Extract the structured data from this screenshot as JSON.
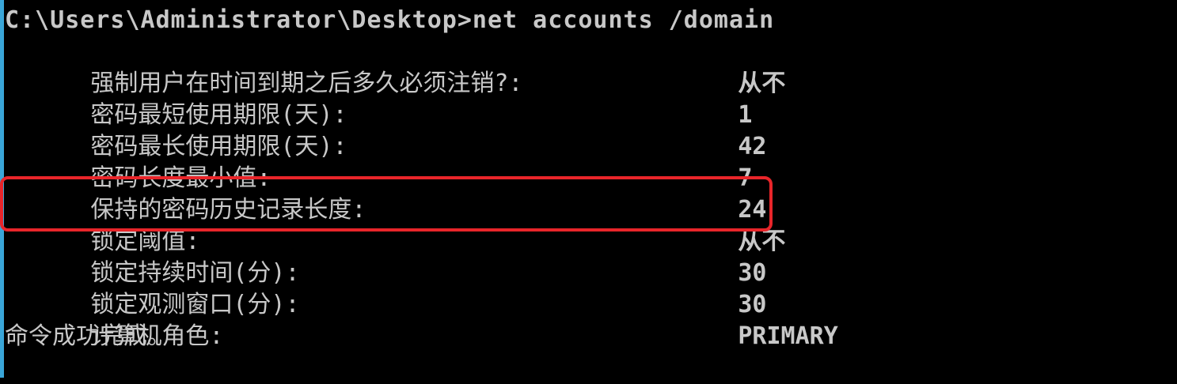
{
  "prompt_line": "C:\\Users\\Administrator\\Desktop>net accounts /domain",
  "rows": [
    {
      "label": "强制用户在时间到期之后多久必须注销?:",
      "value": "从不"
    },
    {
      "label": "密码最短使用期限(天):",
      "value": "1"
    },
    {
      "label": "密码最长使用期限(天):",
      "value": "42"
    },
    {
      "label": "密码长度最小值:",
      "value": "7"
    },
    {
      "label": "保持的密码历史记录长度:",
      "value": "24"
    },
    {
      "label": "锁定阈值:",
      "value": "从不"
    },
    {
      "label": "锁定持续时间(分):",
      "value": "30"
    },
    {
      "label": "锁定观测窗口(分):",
      "value": "30"
    },
    {
      "label": "计算机角色:",
      "value": "PRIMARY"
    }
  ],
  "completion_message": "命令成功完成。",
  "colors": {
    "background": "#000000",
    "text": "#c8c8c8",
    "highlight_border": "#e8252a",
    "left_edge": "#3aa6d8"
  }
}
